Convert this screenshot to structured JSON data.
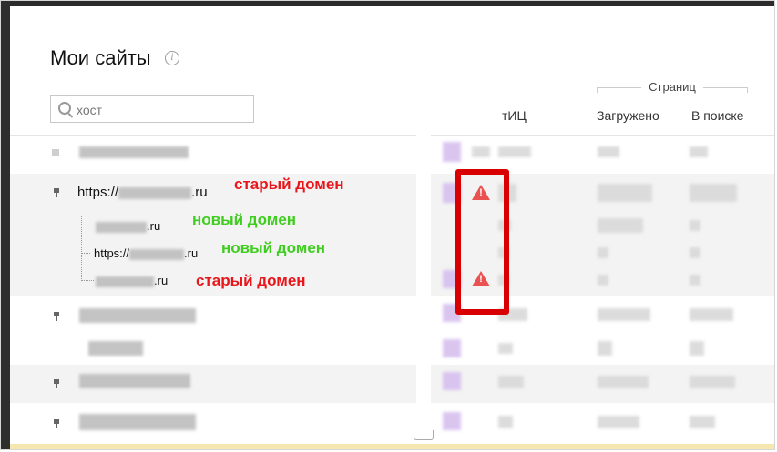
{
  "header": {
    "title": "Мои сайты",
    "info_icon": "i"
  },
  "search": {
    "placeholder": "хост"
  },
  "columns": {
    "group_label": "Страниц",
    "tic": "тИЦ",
    "loaded": "Загружено",
    "in_search": "В поиске"
  },
  "sites": {
    "row1_prefix": "https://",
    "row1_suffix": ".ru",
    "sub1_suffix": ".ru",
    "sub2_prefix": "https://",
    "sub2_suffix": ".ru",
    "sub3_suffix": ".ru"
  },
  "annotations": {
    "old_domain_1": "старый домен",
    "new_domain_1": "новый домен",
    "new_domain_2": "новый домен",
    "old_domain_2": "старый домен"
  },
  "icons": {
    "search": "search-icon",
    "info": "info-icon",
    "pin": "pin-icon",
    "warning": "warning-icon"
  },
  "colors": {
    "annotation_red": "#e8161b",
    "annotation_green": "#3fce1f",
    "warning": "#ea5151",
    "highlight_border": "#d80000"
  }
}
